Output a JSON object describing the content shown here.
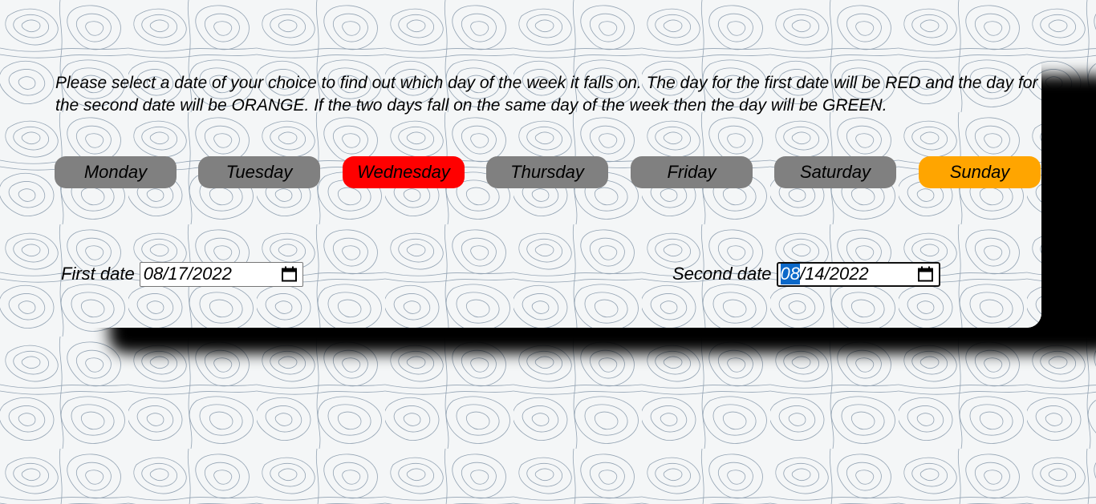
{
  "instructions": "Please select a date of your choice to find out which day of the week it falls on. The day for the first date will be RED and the day for the second date will be ORANGE. If the two days fall on the same day of the week then the day will be GREEN.",
  "days": [
    {
      "label": "Monday",
      "color": "#808080"
    },
    {
      "label": "Tuesday",
      "color": "#808080"
    },
    {
      "label": "Wednesday",
      "color": "#ff0000"
    },
    {
      "label": "Thursday",
      "color": "#808080"
    },
    {
      "label": "Friday",
      "color": "#808080"
    },
    {
      "label": "Saturday",
      "color": "#808080"
    },
    {
      "label": "Sunday",
      "color": "#ffa500"
    }
  ],
  "first_date": {
    "label": "First date",
    "month": "08",
    "rest": "/17/2022"
  },
  "second_date": {
    "label": "Second date",
    "month": "08",
    "rest": "/14/2022"
  },
  "icons": {
    "calendar": "calendar-icon"
  },
  "colors": {
    "first_day": "#ff0000",
    "second_day": "#ffa500",
    "same_day": "#00a000",
    "inactive_day": "#808080",
    "shadow": "#000000",
    "contour_line": "#8a9aaa"
  }
}
